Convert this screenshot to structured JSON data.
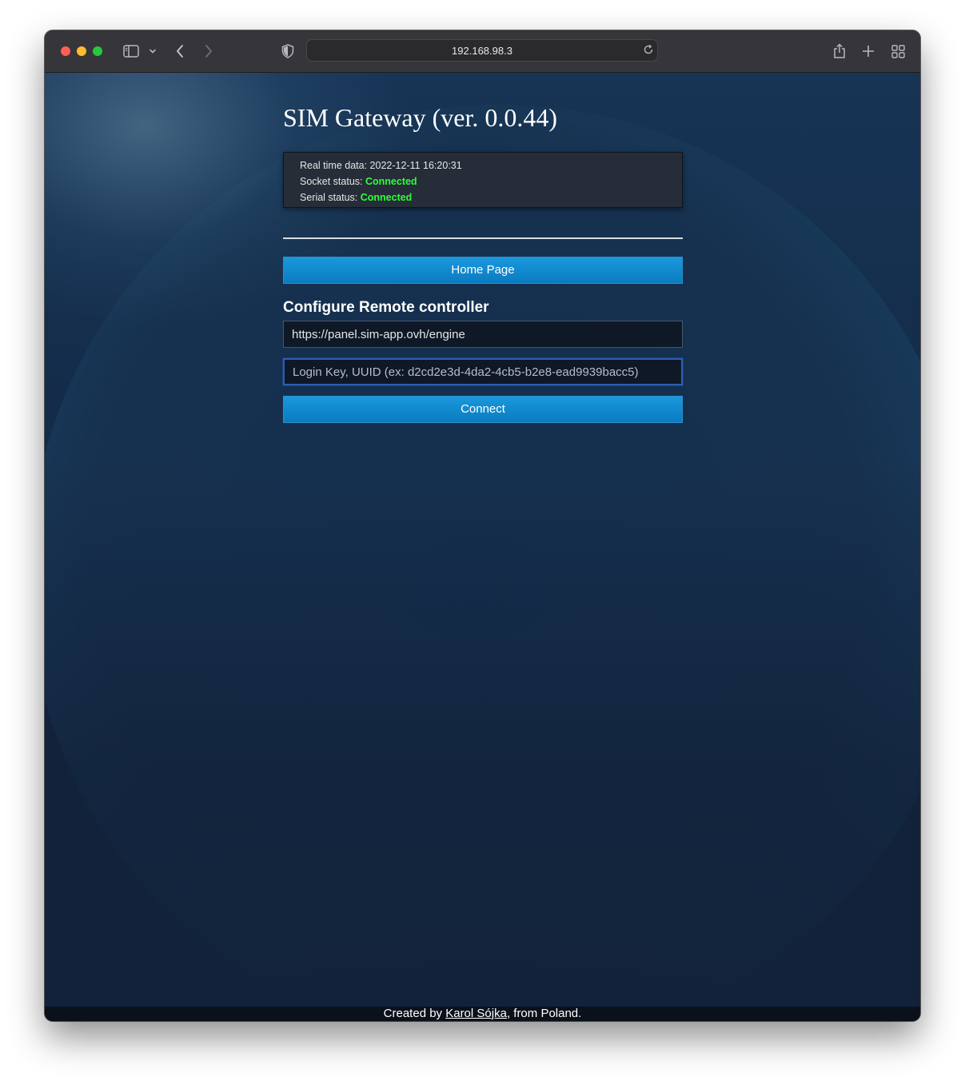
{
  "browser": {
    "url": "192.168.98.3"
  },
  "page": {
    "title": "SIM Gateway (ver. 0.0.44)",
    "status": {
      "realtime_label": "Real time data: ",
      "realtime_value": "2022-12-11 16:20:31",
      "socket_label": "Socket status: ",
      "socket_value": "Connected",
      "serial_label": "Serial status: ",
      "serial_value": "Connected",
      "ok_color": "#2cff3a"
    },
    "home_button": "Home Page",
    "section_title": "Configure Remote controller",
    "remote_url_value": "https://panel.sim-app.ovh/engine",
    "login_key_placeholder": "Login Key, UUID (ex: d2cd2e3d-4da2-4cb5-b2e8-ead9939bacc5)",
    "connect_button": "Connect",
    "footer": {
      "prefix": "Created by ",
      "author": "Karol Sójka",
      "suffix": ", from Poland."
    }
  },
  "colors": {
    "accent": "#0b7bc0",
    "background": "#13233b"
  }
}
